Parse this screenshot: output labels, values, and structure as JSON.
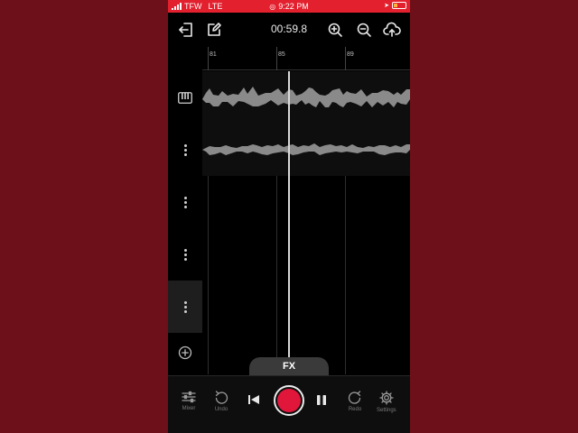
{
  "status_bar": {
    "carrier": "TFW",
    "network": "LTE",
    "time": "9:22 PM"
  },
  "toolbar": {
    "time_display": "00:59.8",
    "icons": [
      "exit-icon",
      "edit-icon",
      "zoom-in-icon",
      "zoom-out-icon",
      "upload-icon"
    ]
  },
  "ruler": {
    "markers": [
      "81",
      "85",
      "89"
    ]
  },
  "tracks": [
    {
      "kind": "instrument",
      "icon": "piano-icon"
    },
    {
      "kind": "audio",
      "icon": "kebab-menu-icon"
    },
    {
      "kind": "empty",
      "icon": "kebab-menu-icon"
    },
    {
      "kind": "empty",
      "icon": "kebab-menu-icon"
    },
    {
      "kind": "empty",
      "icon": "kebab-menu-icon",
      "selected": true
    }
  ],
  "fx": {
    "label": "FX"
  },
  "transport": {
    "mixer_label": "Mixer",
    "undo_label": "Undo",
    "redo_label": "Redo",
    "settings_label": "Settings"
  },
  "colors": {
    "background": "#6e1019",
    "status_bar": "#e3202e",
    "record": "#e0163b",
    "waveform": "#8a8a8a"
  }
}
